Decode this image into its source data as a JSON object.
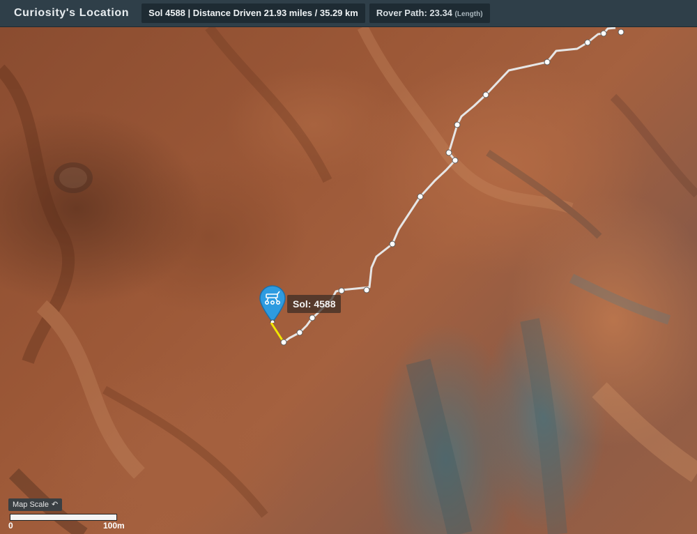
{
  "header": {
    "title": "Curiosity's Location",
    "sol_distance": "Sol 4588 | Distance Driven 21.93 miles / 35.29 km",
    "rover_path_label": "Rover Path: 23.34",
    "rover_path_unit": "(Length)"
  },
  "map": {
    "marker_label": "Sol: 4588",
    "marker_icon": "rover-icon",
    "path_color": "#e6e6e6",
    "last_leg_color": "#f2e600",
    "marker_color": "#2e9be0"
  },
  "scale": {
    "button_label": "Map Scale",
    "button_icon": "undo-icon",
    "start_label": "0",
    "end_label": "100m"
  }
}
